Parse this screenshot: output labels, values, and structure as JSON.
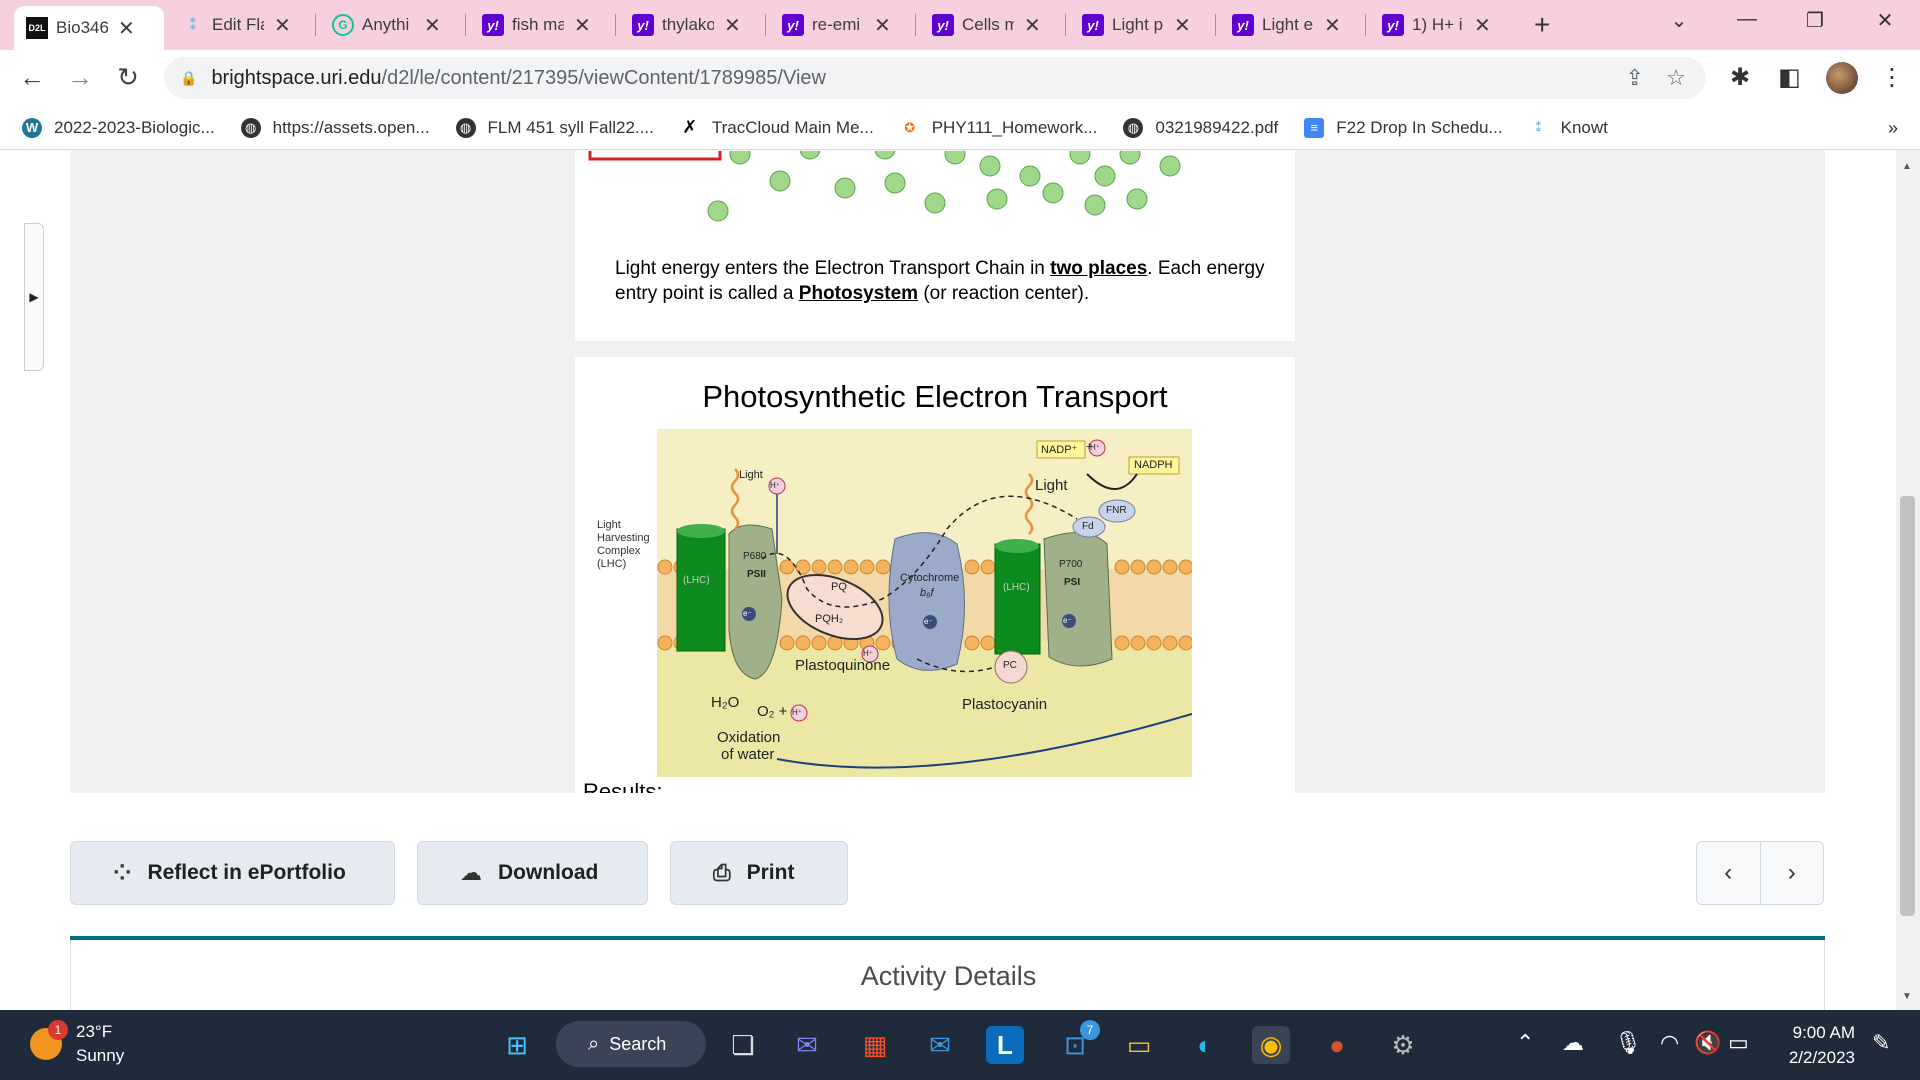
{
  "browser": {
    "tabs": [
      {
        "label": "Bio346",
        "favicon": "d2l-icon",
        "active": true
      },
      {
        "label": "Edit Fla",
        "favicon": "knowt-icon"
      },
      {
        "label": "Anythi",
        "favicon": "grammarly-icon"
      },
      {
        "label": "fish ma",
        "favicon": "yahoo-icon"
      },
      {
        "label": "thylako",
        "favicon": "yahoo-icon"
      },
      {
        "label": "re-emi",
        "favicon": "yahoo-icon"
      },
      {
        "label": "Cells m",
        "favicon": "yahoo-icon"
      },
      {
        "label": "Light p",
        "favicon": "yahoo-icon"
      },
      {
        "label": "Light e",
        "favicon": "yahoo-icon"
      },
      {
        "label": "1) H+ i",
        "favicon": "yahoo-icon"
      }
    ],
    "url_host": "brightspace.uri.edu",
    "url_path": "/d2l/le/content/217395/viewContent/1789985/View",
    "bookmarks": [
      {
        "label": "2022-2023-Biologic...",
        "icon": "wordpress-icon"
      },
      {
        "label": "https://assets.open...",
        "icon": "globe-icon"
      },
      {
        "label": "FLM 451 syll Fall22....",
        "icon": "globe-icon"
      },
      {
        "label": "TracCloud Main Me...",
        "icon": "traccloud-icon"
      },
      {
        "label": "PHY111_Homework...",
        "icon": "pearson-icon"
      },
      {
        "label": "0321989422.pdf",
        "icon": "globe-icon"
      },
      {
        "label": "F22 Drop In Schedu...",
        "icon": "docs-icon"
      },
      {
        "label": "Knowt",
        "icon": "knowt-icon"
      }
    ],
    "bookmarks_more": "»"
  },
  "content": {
    "slide1_text_a": "Light energy enters the Electron Transport Chain in ",
    "slide1_bold_a": "two places",
    "slide1_text_b": ".  Each energy entry point is called a ",
    "slide1_bold_b": "Photosystem",
    "slide1_text_c": " (or reaction center).",
    "slide2_title": "Photosynthetic Electron Transport",
    "results_partial": "Results:",
    "diagram": {
      "lhc_side_label": [
        "Light",
        "Harvesting",
        "Complex",
        "(LHC)"
      ],
      "light_left": "Light",
      "light_right": "Light",
      "nadp": "NADP⁺",
      "plus": "+",
      "nadph": "NADPH",
      "fnr": "FNR",
      "fd": "Fd",
      "p680": "P680",
      "psii": "PSII",
      "lhc": "(LHC)",
      "pq": "PQ",
      "pqh2": "PQH₂",
      "cytochrome": "Cytochrome",
      "b6f": "b₆f",
      "p700": "P700",
      "psi": "PSI",
      "pc": "PC",
      "plastoquinone": "Plastoquinone",
      "plastocyanin": "Plastocyanin",
      "h2o": "H₂O",
      "o2": "O₂ +",
      "oxidation": [
        "Oxidation",
        "of water"
      ],
      "h_plus": "H⁺",
      "electron": "e⁻"
    }
  },
  "actions": {
    "reflect": "Reflect in ePortfolio",
    "download": "Download",
    "print": "Print",
    "prev": "‹",
    "next": "›"
  },
  "activity_details": "Activity Details",
  "taskbar": {
    "badge": "1",
    "temperature": "23°F",
    "condition": "Sunny",
    "search": "Search",
    "mail_badge": "7",
    "time": "9:00 AM",
    "date": "2/2/2023"
  }
}
